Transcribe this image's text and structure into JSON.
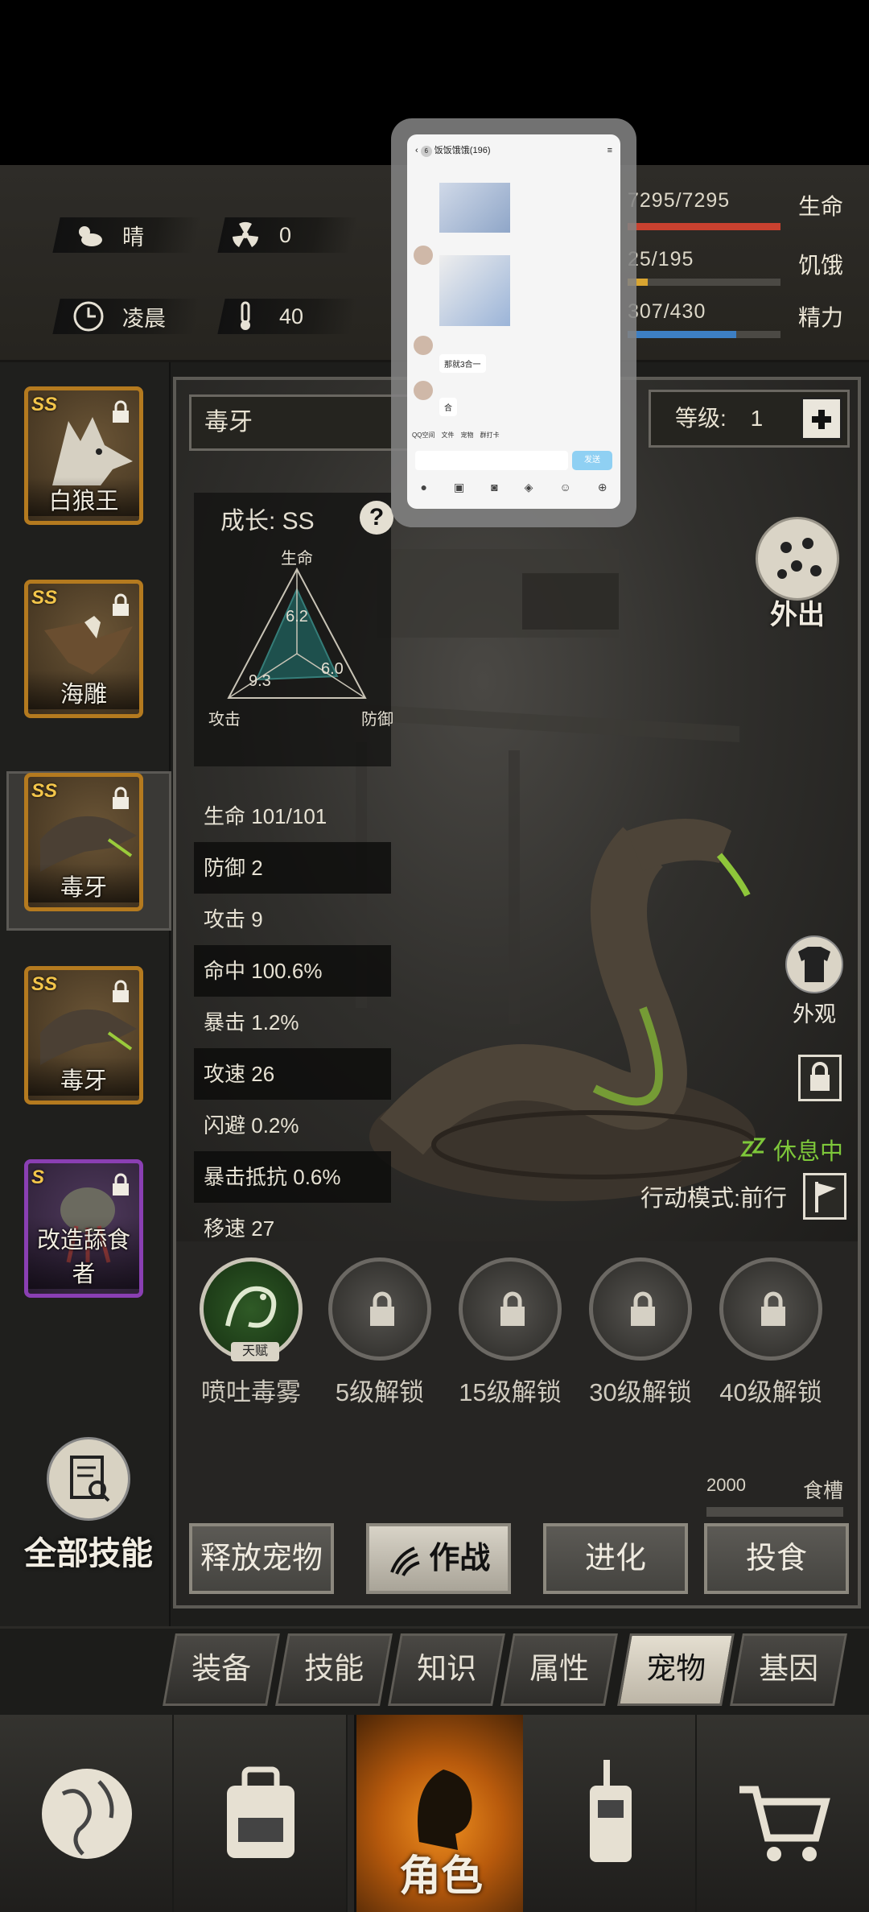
{
  "status": {
    "weather": "晴",
    "radiation": "0",
    "time_of_day": "凌晨",
    "temperature": "40",
    "bars": [
      {
        "value": "7295/7295",
        "label": "生命",
        "fraction": 1.0,
        "color": "#c9412f"
      },
      {
        "value": "25/195",
        "label": "饥饿",
        "fraction": 0.13,
        "color": "#d9a531"
      },
      {
        "value": "307/430",
        "label": "精力",
        "fraction": 0.71,
        "color": "#3d7fc4"
      }
    ]
  },
  "pets": [
    {
      "rank": "SS",
      "name": "白狼王",
      "style": "gold"
    },
    {
      "rank": "SS",
      "name": "海雕",
      "style": "gold"
    },
    {
      "rank": "SS",
      "name": "毒牙",
      "style": "gold",
      "selected": true
    },
    {
      "rank": "SS",
      "name": "毒牙",
      "style": "gold"
    },
    {
      "rank": "S",
      "name": "改造舔食者",
      "style": "purple"
    }
  ],
  "all_skills_label": "全部技能",
  "detail": {
    "pet_name": "毒牙",
    "level_label": "等级:",
    "level_value": "1",
    "growth_label": "成长: SS",
    "help_glyph": "?",
    "radar": {
      "top_label": "生命",
      "left_label": "攻击",
      "right_label": "防御",
      "top_value": "6.2",
      "left_value": "9.3",
      "right_value": "6.0"
    },
    "stats": [
      {
        "label": "生命",
        "value": "101/101"
      },
      {
        "label": "防御",
        "value": "2"
      },
      {
        "label": "攻击",
        "value": "9"
      },
      {
        "label": "命中",
        "value": "100.6%"
      },
      {
        "label": "暴击",
        "value": "1.2%"
      },
      {
        "label": "攻速",
        "value": "26"
      },
      {
        "label": "闪避",
        "value": "0.2%"
      },
      {
        "label": "暴击抵抗",
        "value": "0.6%"
      },
      {
        "label": "移速",
        "value": "27"
      }
    ],
    "outing_label": "外出",
    "appearance_label": "外观",
    "resting_label": "休息中",
    "mode_label": "行动模式:前行",
    "skills": [
      {
        "caption": "喷吐毒雾",
        "talent_tag": "天赋",
        "locked": false
      },
      {
        "caption": "5级解锁",
        "locked": true
      },
      {
        "caption": "15级解锁",
        "locked": true
      },
      {
        "caption": "30级解锁",
        "locked": true
      },
      {
        "caption": "40级解锁",
        "locked": true
      }
    ],
    "food_value": "2000",
    "food_label": "食槽",
    "actions": {
      "release": "释放宠物",
      "fight": "作战",
      "evolve": "进化",
      "feed": "投食"
    }
  },
  "tabs": [
    "装备",
    "技能",
    "知识",
    "属性",
    "宠物",
    "基因"
  ],
  "active_tab": "宠物",
  "nav": {
    "active_label": "角色"
  },
  "chat_overlay": {
    "title": "饭饭饿饿(196)",
    "badge": "6",
    "bubble_1": "那就3合一",
    "bubble_2": "合",
    "apps": [
      "QQ空间",
      "文件",
      "宠物",
      "群打卡"
    ],
    "send": "发送"
  }
}
